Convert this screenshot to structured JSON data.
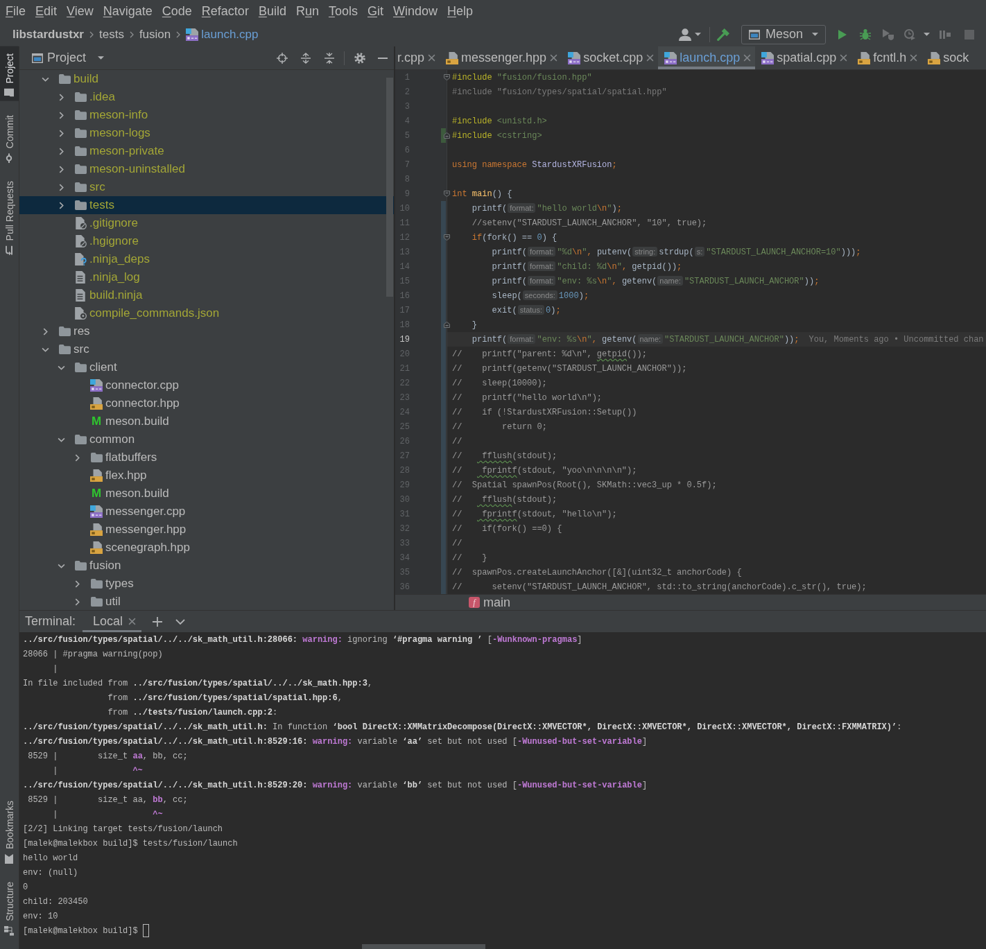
{
  "menu_bar": [
    {
      "label": "File",
      "kind": "first"
    },
    {
      "label": "Edit",
      "kind": "first"
    },
    {
      "label": "View",
      "kind": "first"
    },
    {
      "label": "Navigate",
      "kind": "first"
    },
    {
      "label": "Code",
      "kind": "first"
    },
    {
      "label": "Refactor",
      "kind": "first"
    },
    {
      "label": "Build",
      "kind": "first"
    },
    {
      "label": "Run",
      "kind": "second"
    },
    {
      "label": "Tools",
      "kind": "first"
    },
    {
      "label": "Git",
      "kind": "first"
    },
    {
      "label": "Window",
      "kind": "first"
    },
    {
      "label": "Help",
      "kind": "first"
    }
  ],
  "breadcrumbs": [
    {
      "label": "libstardustxr",
      "kind": "project",
      "modified": false
    },
    {
      "label": "tests",
      "kind": "folder",
      "modified": false
    },
    {
      "label": "fusion",
      "kind": "folder",
      "modified": false
    },
    {
      "label": "launch.cpp",
      "kind": "cpp",
      "modified": true
    }
  ],
  "run_configuration": {
    "label": "Meson"
  },
  "tool_windows": {
    "top": [
      {
        "label": "Project",
        "kind": "project",
        "selected": true
      },
      {
        "label": "Commit",
        "kind": "commit",
        "selected": false
      },
      {
        "label": "Pull Requests",
        "kind": "pull_requests",
        "selected": false
      }
    ],
    "bottom": [
      {
        "label": "Bookmarks",
        "kind": "bookmarks",
        "selected": false
      },
      {
        "label": "Structure",
        "kind": "structure",
        "selected": false
      }
    ]
  },
  "project_panel": {
    "title": "Project",
    "tree": [
      {
        "name": "build",
        "kind": "folder",
        "expanded": true,
        "excluded": true,
        "selected": false,
        "children": [
          {
            "name": ".idea",
            "kind": "folder",
            "expanded": false,
            "excluded": true,
            "selected": false
          },
          {
            "name": "meson-info",
            "kind": "folder",
            "expanded": false,
            "excluded": true,
            "selected": false
          },
          {
            "name": "meson-logs",
            "kind": "folder",
            "expanded": false,
            "excluded": true,
            "selected": false
          },
          {
            "name": "meson-private",
            "kind": "folder",
            "expanded": false,
            "excluded": true,
            "selected": false
          },
          {
            "name": "meson-uninstalled",
            "kind": "folder",
            "expanded": false,
            "excluded": true,
            "selected": false
          },
          {
            "name": "src",
            "kind": "folder",
            "expanded": false,
            "excluded": true,
            "selected": false
          },
          {
            "name": "tests",
            "kind": "folder",
            "expanded": false,
            "excluded": true,
            "selected": true
          },
          {
            "name": ".gitignore",
            "kind": "ignore",
            "excluded": true,
            "selected": false
          },
          {
            "name": ".hgignore",
            "kind": "ignore",
            "excluded": true,
            "selected": false
          },
          {
            "name": ".ninja_deps",
            "kind": "unknown",
            "excluded": true,
            "selected": false
          },
          {
            "name": ".ninja_log",
            "kind": "text",
            "excluded": true,
            "selected": false
          },
          {
            "name": "build.ninja",
            "kind": "text",
            "excluded": true,
            "selected": false
          },
          {
            "name": "compile_commands.json",
            "kind": "json",
            "excluded": true,
            "selected": false
          }
        ]
      },
      {
        "name": "res",
        "kind": "folder",
        "expanded": false,
        "excluded": false,
        "selected": false
      },
      {
        "name": "src",
        "kind": "folder",
        "expanded": true,
        "excluded": false,
        "selected": false,
        "children": [
          {
            "name": "client",
            "kind": "folder",
            "expanded": true,
            "excluded": false,
            "selected": false,
            "children": [
              {
                "name": "connector.cpp",
                "kind": "cpp",
                "excluded": false,
                "selected": false
              },
              {
                "name": "connector.hpp",
                "kind": "header",
                "excluded": false,
                "selected": false
              },
              {
                "name": "meson.build",
                "kind": "meson",
                "glyph": "M",
                "excluded": false,
                "selected": false
              }
            ]
          },
          {
            "name": "common",
            "kind": "folder",
            "expanded": true,
            "excluded": false,
            "selected": false,
            "children": [
              {
                "name": "flatbuffers",
                "kind": "folder",
                "expanded": false,
                "excluded": false,
                "selected": false
              },
              {
                "name": "flex.hpp",
                "kind": "header",
                "excluded": false,
                "selected": false
              },
              {
                "name": "meson.build",
                "kind": "meson",
                "glyph": "M",
                "excluded": false,
                "selected": false
              },
              {
                "name": "messenger.cpp",
                "kind": "cpp",
                "excluded": false,
                "selected": false
              },
              {
                "name": "messenger.hpp",
                "kind": "header",
                "excluded": false,
                "selected": false
              },
              {
                "name": "scenegraph.hpp",
                "kind": "header",
                "excluded": false,
                "selected": false
              }
            ]
          },
          {
            "name": "fusion",
            "kind": "folder",
            "expanded": true,
            "excluded": false,
            "selected": false,
            "children": [
              {
                "name": "types",
                "kind": "folder",
                "expanded": false,
                "excluded": false,
                "selected": false
              },
              {
                "name": "util",
                "kind": "folder",
                "expanded": false,
                "excluded": false,
                "selected": false
              }
            ]
          }
        ]
      }
    ]
  },
  "editor": {
    "tabs": [
      {
        "label": "r.cpp",
        "kind": "plain",
        "selected": false,
        "modified": false,
        "closable": true
      },
      {
        "label": "messenger.hpp",
        "kind": "header",
        "selected": false,
        "modified": false,
        "closable": true
      },
      {
        "label": "socket.cpp",
        "kind": "cpp",
        "selected": false,
        "modified": false,
        "closable": true
      },
      {
        "label": "launch.cpp",
        "kind": "cpp",
        "selected": true,
        "modified": true,
        "closable": true
      },
      {
        "label": "spatial.cpp",
        "kind": "cpp",
        "selected": false,
        "modified": false,
        "closable": true
      },
      {
        "label": "fcntl.h",
        "kind": "header",
        "selected": false,
        "modified": false,
        "closable": true
      },
      {
        "label": "sock",
        "kind": "header",
        "selected": false,
        "modified": false,
        "closable": false
      }
    ],
    "lines": [
      {
        "number": "1",
        "kind": "plain",
        "current": false,
        "fold_start": true,
        "tokens": [
          {
            "kind": "directive",
            "text": "#include"
          },
          {
            "kind": "string",
            "text": " \"fusion/fusion.hpp\""
          }
        ]
      },
      {
        "number": "2",
        "kind": "plain",
        "current": false,
        "tokens": [
          {
            "kind": "unused",
            "text": "#include \"fusion/types/spatial/spatial.hpp\""
          }
        ]
      },
      {
        "number": "3",
        "kind": "plain",
        "current": false
      },
      {
        "number": "4",
        "kind": "plain",
        "current": false,
        "tokens": [
          {
            "kind": "directive",
            "text": "#include"
          },
          {
            "kind": "string",
            "text": " <unistd.h>"
          }
        ]
      },
      {
        "number": "5",
        "kind": "added",
        "current": false,
        "fold_end": true,
        "tokens": [
          {
            "kind": "directive",
            "text": "#include"
          },
          {
            "kind": "string",
            "text": " <cstring>"
          }
        ]
      },
      {
        "number": "6",
        "kind": "plain",
        "current": false
      },
      {
        "number": "7",
        "kind": "plain",
        "current": false,
        "tokens": [
          {
            "kind": "keyword",
            "text": "using namespace "
          },
          {
            "kind": "namespace",
            "text": "StardustXRFusion"
          },
          {
            "kind": "keyword",
            "text": ";"
          }
        ]
      },
      {
        "number": "8",
        "kind": "plain",
        "current": false
      },
      {
        "number": "9",
        "kind": "plain",
        "current": false,
        "fold_start": true,
        "tokens": [
          {
            "kind": "keyword",
            "text": "int "
          },
          {
            "kind": "function",
            "text": "main"
          },
          {
            "kind": "plain",
            "text": "() {"
          }
        ],
        "children": [
          {
            "number": "10",
            "kind": "modified",
            "current": false,
            "tokens": [
              {
                "kind": "plain",
                "text": "printf("
              },
              {
                "kind": "hint",
                "text": "format:"
              },
              {
                "kind": "string",
                "text": "\"hello world"
              },
              {
                "kind": "escape",
                "text": "\\n"
              },
              {
                "kind": "string",
                "text": "\""
              },
              {
                "kind": "plain",
                "text": ")"
              },
              {
                "kind": "keyword",
                "text": ";"
              }
            ]
          },
          {
            "number": "11",
            "kind": "modified",
            "current": false,
            "tokens": [
              {
                "kind": "comment",
                "text": "//setenv(\"STARDUST_LAUNCH_ANCHOR\", \"10\", true);"
              }
            ]
          },
          {
            "number": "12",
            "kind": "modified",
            "current": false,
            "fold_start": true,
            "tokens": [
              {
                "kind": "keyword",
                "text": "if"
              },
              {
                "kind": "plain",
                "text": "(fork() == "
              },
              {
                "kind": "number",
                "text": "0"
              },
              {
                "kind": "plain",
                "text": ") {"
              }
            ],
            "children": [
              {
                "number": "13",
                "kind": "modified",
                "current": false,
                "tokens": [
                  {
                    "kind": "plain",
                    "text": "printf("
                  },
                  {
                    "kind": "hint",
                    "text": "format:"
                  },
                  {
                    "kind": "string",
                    "text": "\"%d"
                  },
                  {
                    "kind": "escape",
                    "text": "\\n"
                  },
                  {
                    "kind": "string",
                    "text": "\""
                  },
                  {
                    "kind": "keyword",
                    "text": ", "
                  },
                  {
                    "kind": "plain",
                    "text": "putenv("
                  },
                  {
                    "kind": "hint",
                    "text": "string:"
                  },
                  {
                    "kind": "plain",
                    "text": "strdup("
                  },
                  {
                    "kind": "hint",
                    "text": "s:"
                  },
                  {
                    "kind": "string",
                    "text": "\"STARDUST_LAUNCH_ANCHOR=10\""
                  },
                  {
                    "kind": "plain",
                    "text": ")))"
                  },
                  {
                    "kind": "keyword",
                    "text": ";"
                  }
                ]
              },
              {
                "number": "14",
                "kind": "modified",
                "current": false,
                "tokens": [
                  {
                    "kind": "plain",
                    "text": "printf("
                  },
                  {
                    "kind": "hint",
                    "text": "format:"
                  },
                  {
                    "kind": "string",
                    "text": "\"child: %d"
                  },
                  {
                    "kind": "escape",
                    "text": "\\n"
                  },
                  {
                    "kind": "string",
                    "text": "\""
                  },
                  {
                    "kind": "keyword",
                    "text": ", "
                  },
                  {
                    "kind": "plain",
                    "text": "getpid())"
                  },
                  {
                    "kind": "keyword",
                    "text": ";"
                  }
                ]
              },
              {
                "number": "15",
                "kind": "modified",
                "current": false,
                "tokens": [
                  {
                    "kind": "plain",
                    "text": "printf("
                  },
                  {
                    "kind": "hint",
                    "text": "format:"
                  },
                  {
                    "kind": "string",
                    "text": "\"env: %s"
                  },
                  {
                    "kind": "escape",
                    "text": "\\n"
                  },
                  {
                    "kind": "string",
                    "text": "\""
                  },
                  {
                    "kind": "keyword",
                    "text": ", "
                  },
                  {
                    "kind": "plain",
                    "text": "getenv("
                  },
                  {
                    "kind": "hint",
                    "text": "name:"
                  },
                  {
                    "kind": "string",
                    "text": "\"STARDUST_LAUNCH_ANCHOR\""
                  },
                  {
                    "kind": "plain",
                    "text": "))"
                  },
                  {
                    "kind": "keyword",
                    "text": ";"
                  }
                ]
              },
              {
                "number": "16",
                "kind": "modified",
                "current": false,
                "tokens": [
                  {
                    "kind": "plain",
                    "text": "sleep("
                  },
                  {
                    "kind": "hint",
                    "text": "seconds:"
                  },
                  {
                    "kind": "number",
                    "text": "1000"
                  },
                  {
                    "kind": "plain",
                    "text": ")"
                  },
                  {
                    "kind": "keyword",
                    "text": ";"
                  }
                ]
              },
              {
                "number": "17",
                "kind": "modified",
                "current": false,
                "tokens": [
                  {
                    "kind": "plain",
                    "text": "exit("
                  },
                  {
                    "kind": "hint",
                    "text": "status:"
                  },
                  {
                    "kind": "number",
                    "text": "0"
                  },
                  {
                    "kind": "plain",
                    "text": ")"
                  },
                  {
                    "kind": "keyword",
                    "text": ";"
                  }
                ]
              }
            ]
          },
          {
            "number": "18",
            "kind": "modified",
            "current": false,
            "fold_end": true,
            "tokens": [
              {
                "kind": "plain",
                "text": "}"
              }
            ]
          },
          {
            "number": "19",
            "kind": "modified",
            "current": true,
            "tokens": [
              {
                "kind": "plain",
                "text": "printf("
              },
              {
                "kind": "hint",
                "text": "format:"
              },
              {
                "kind": "string",
                "text": "\"env: %s"
              },
              {
                "kind": "escape",
                "text": "\\n"
              },
              {
                "kind": "string",
                "text": "\""
              },
              {
                "kind": "keyword",
                "text": ", "
              },
              {
                "kind": "plain",
                "text": "getenv("
              },
              {
                "kind": "hint",
                "text": "name:"
              },
              {
                "kind": "string",
                "text": "\"STARDUST_LAUNCH_ANCHOR\""
              },
              {
                "kind": "plain",
                "text": "))"
              },
              {
                "kind": "keyword",
                "text": ";"
              }
            ],
            "annotation": "You, Moments ago • Uncommitted chan"
          }
        ]
      },
      {
        "number": "20",
        "kind": "modified",
        "current": false,
        "tokens": [
          {
            "kind": "comment",
            "text": "//"
          },
          {
            "kind": "space4"
          },
          {
            "kind": "comment",
            "text": "printf(\"parent: %d\\n\", "
          },
          {
            "kind": "squiggle",
            "text": "getpid"
          },
          {
            "kind": "comment",
            "text": "());"
          }
        ]
      },
      {
        "number": "21",
        "kind": "modified",
        "current": false,
        "tokens": [
          {
            "kind": "comment",
            "text": "//"
          },
          {
            "kind": "space4"
          },
          {
            "kind": "comment",
            "text": "printf(getenv(\"STARDUST_LAUNCH_ANCHOR\"));"
          }
        ]
      },
      {
        "number": "22",
        "kind": "modified",
        "current": false,
        "tokens": [
          {
            "kind": "comment",
            "text": "//"
          },
          {
            "kind": "space4"
          },
          {
            "kind": "comment",
            "text": "sleep(10000);"
          }
        ]
      },
      {
        "number": "23",
        "kind": "modified",
        "current": false,
        "tokens": [
          {
            "kind": "comment",
            "text": "//"
          },
          {
            "kind": "space4"
          },
          {
            "kind": "comment",
            "text": "printf(\"hello world\\n\");"
          }
        ]
      },
      {
        "number": "24",
        "kind": "modified",
        "current": false,
        "tokens": [
          {
            "kind": "comment",
            "text": "//"
          },
          {
            "kind": "space4"
          },
          {
            "kind": "comment",
            "text": "if (!StardustXRFusion::Setup())"
          }
        ]
      },
      {
        "number": "25",
        "kind": "modified",
        "current": false,
        "tokens": [
          {
            "kind": "comment",
            "text": "//"
          },
          {
            "kind": "space8"
          },
          {
            "kind": "comment",
            "text": "return 0;"
          }
        ]
      },
      {
        "number": "26",
        "kind": "modified",
        "current": false,
        "tokens": [
          {
            "kind": "comment",
            "text": "//"
          }
        ]
      },
      {
        "number": "27",
        "kind": "modified",
        "current": false,
        "tokens": [
          {
            "kind": "comment",
            "text": "//"
          },
          {
            "kind": "space4"
          },
          {
            "kind": "squiggle",
            "text": "fflush"
          },
          {
            "kind": "comment",
            "text": "(stdout);"
          }
        ]
      },
      {
        "number": "28",
        "kind": "modified",
        "current": false,
        "tokens": [
          {
            "kind": "comment",
            "text": "//"
          },
          {
            "kind": "space4"
          },
          {
            "kind": "squiggle",
            "text": "fprintf"
          },
          {
            "kind": "comment",
            "text": "(stdout, \"yoo\\n\\n\\n\\n\");"
          }
        ]
      },
      {
        "number": "29",
        "kind": "modified",
        "current": false,
        "tokens": [
          {
            "kind": "comment",
            "text": "//"
          },
          {
            "kind": "space2"
          },
          {
            "kind": "comment",
            "text": "Spatial spawnPos(Root(), SKMath::vec3_up * 0.5f);"
          }
        ]
      },
      {
        "number": "30",
        "kind": "modified",
        "current": false,
        "tokens": [
          {
            "kind": "comment",
            "text": "//"
          },
          {
            "kind": "space4"
          },
          {
            "kind": "squiggle",
            "text": "fflush"
          },
          {
            "kind": "comment",
            "text": "(stdout);"
          }
        ]
      },
      {
        "number": "31",
        "kind": "modified",
        "current": false,
        "tokens": [
          {
            "kind": "comment",
            "text": "//"
          },
          {
            "kind": "space4"
          },
          {
            "kind": "squiggle",
            "text": "fprintf"
          },
          {
            "kind": "comment",
            "text": "(stdout, \"hello\\n\");"
          }
        ]
      },
      {
        "number": "32",
        "kind": "modified",
        "current": false,
        "tokens": [
          {
            "kind": "comment",
            "text": "//"
          },
          {
            "kind": "space4"
          },
          {
            "kind": "comment",
            "text": "if(fork() ==0) {"
          }
        ]
      },
      {
        "number": "33",
        "kind": "modified",
        "current": false,
        "tokens": [
          {
            "kind": "comment",
            "text": "//"
          }
        ]
      },
      {
        "number": "34",
        "kind": "modified",
        "current": false,
        "tokens": [
          {
            "kind": "comment",
            "text": "//"
          },
          {
            "kind": "space4"
          },
          {
            "kind": "comment",
            "text": "}"
          }
        ]
      },
      {
        "number": "35",
        "kind": "modified",
        "current": false,
        "tokens": [
          {
            "kind": "comment",
            "text": "//"
          },
          {
            "kind": "space2"
          },
          {
            "kind": "comment",
            "text": "spawnPos.createLaunchAnchor([&](uint32_t anchorCode) {"
          }
        ]
      },
      {
        "number": "36",
        "kind": "modified",
        "current": false,
        "tokens": [
          {
            "kind": "comment",
            "text": "//"
          },
          {
            "kind": "space6"
          },
          {
            "kind": "comment",
            "text": "setenv(\"STARDUST_LAUNCH_ANCHOR\", std::to_string(anchorCode).c_str(), true);"
          }
        ]
      }
    ],
    "breadcrumb": {
      "glyph": "f",
      "label": "main"
    }
  },
  "terminal": {
    "title": "Terminal:",
    "tabs": [
      {
        "label": "Local",
        "selected": true,
        "closable": true
      }
    ],
    "cursor": true,
    "lines": [
      {
        "tokens": [
          {
            "kind": "bold",
            "text": "../src/fusion/types/spatial/../../sk_math_util.h:28066:"
          },
          {
            "kind": "space1"
          },
          {
            "kind": "warning",
            "text": "warning:"
          },
          {
            "kind": "plain",
            "text": " ignoring "
          },
          {
            "kind": "bold",
            "text": "‘#pragma warning ’"
          },
          {
            "kind": "plain",
            "text": " ["
          },
          {
            "kind": "warning",
            "text": "-Wunknown-pragmas"
          },
          {
            "kind": "plain",
            "text": "]"
          }
        ]
      },
      {
        "tokens": [
          {
            "kind": "plain",
            "text": "28066 | #pragma warning(pop)"
          }
        ]
      },
      {
        "tokens": [
          {
            "kind": "space6"
          },
          {
            "kind": "plain",
            "text": "|"
          }
        ]
      },
      {
        "tokens": [
          {
            "kind": "plain",
            "text": "In file included from "
          },
          {
            "kind": "bold",
            "text": "../src/fusion/types/spatial/../../sk_math.hpp:3"
          },
          {
            "kind": "plain",
            "text": ","
          }
        ]
      },
      {
        "tokens": [
          {
            "kind": "space17"
          },
          {
            "kind": "plain",
            "text": "from "
          },
          {
            "kind": "bold",
            "text": "../src/fusion/types/spatial/spatial.hpp:6"
          },
          {
            "kind": "plain",
            "text": ","
          }
        ]
      },
      {
        "tokens": [
          {
            "kind": "space17"
          },
          {
            "kind": "plain",
            "text": "from "
          },
          {
            "kind": "bold",
            "text": "../tests/fusion/launch.cpp:2"
          },
          {
            "kind": "plain",
            "text": ":"
          }
        ]
      },
      {
        "tokens": [
          {
            "kind": "bold",
            "text": "../src/fusion/types/spatial/../../sk_math_util.h:"
          },
          {
            "kind": "plain",
            "text": " In function "
          },
          {
            "kind": "bold",
            "text": "‘bool DirectX::XMMatrixDecompose(DirectX::XMVECTOR*, DirectX::XMVECTOR*, DirectX::XMVECTOR*, DirectX::FXMMATRIX)’"
          },
          {
            "kind": "plain",
            "text": ":"
          }
        ]
      },
      {
        "tokens": [
          {
            "kind": "bold",
            "text": "../src/fusion/types/spatial/../../sk_math_util.h:8529:16:"
          },
          {
            "kind": "space1"
          },
          {
            "kind": "warning",
            "text": "warning:"
          },
          {
            "kind": "plain",
            "text": " variable "
          },
          {
            "kind": "bold",
            "text": "‘aa’"
          },
          {
            "kind": "plain",
            "text": " set but not used ["
          },
          {
            "kind": "warning",
            "text": "-Wunused-but-set-variable"
          },
          {
            "kind": "plain",
            "text": "]"
          }
        ]
      },
      {
        "tokens": [
          {
            "kind": "space1"
          },
          {
            "kind": "plain",
            "text": "8529 |"
          },
          {
            "kind": "space8"
          },
          {
            "kind": "plain",
            "text": "size_t "
          },
          {
            "kind": "warning",
            "text": "aa"
          },
          {
            "kind": "plain",
            "text": ", bb, cc;"
          }
        ]
      },
      {
        "tokens": [
          {
            "kind": "space6"
          },
          {
            "kind": "plain",
            "text": "|"
          },
          {
            "kind": "space15"
          },
          {
            "kind": "warning",
            "text": "^~"
          }
        ]
      },
      {
        "tokens": [
          {
            "kind": "bold",
            "text": "../src/fusion/types/spatial/../../sk_math_util.h:8529:20:"
          },
          {
            "kind": "space1"
          },
          {
            "kind": "warning",
            "text": "warning:"
          },
          {
            "kind": "plain",
            "text": " variable "
          },
          {
            "kind": "bold",
            "text": "‘bb’"
          },
          {
            "kind": "plain",
            "text": " set but not used ["
          },
          {
            "kind": "warning",
            "text": "-Wunused-but-set-variable"
          },
          {
            "kind": "plain",
            "text": "]"
          }
        ]
      },
      {
        "tokens": [
          {
            "kind": "space1"
          },
          {
            "kind": "plain",
            "text": "8529 |"
          },
          {
            "kind": "space8"
          },
          {
            "kind": "plain",
            "text": "size_t aa, "
          },
          {
            "kind": "warning",
            "text": "bb"
          },
          {
            "kind": "plain",
            "text": ", cc;"
          }
        ]
      },
      {
        "tokens": [
          {
            "kind": "space6"
          },
          {
            "kind": "plain",
            "text": "|"
          },
          {
            "kind": "space19"
          },
          {
            "kind": "warning",
            "text": "^~"
          }
        ]
      },
      {
        "tokens": [
          {
            "kind": "plain",
            "text": "[2/2] Linking target tests/fusion/launch"
          }
        ]
      },
      {
        "tokens": [
          {
            "kind": "plain",
            "text": "[malek@malekbox build]$ tests/fusion/launch"
          }
        ]
      },
      {
        "tokens": [
          {
            "kind": "plain",
            "text": "hello world"
          }
        ]
      },
      {
        "tokens": [
          {
            "kind": "plain",
            "text": "env: (null)"
          }
        ]
      },
      {
        "tokens": [
          {
            "kind": "plain",
            "text": "0"
          }
        ]
      },
      {
        "tokens": [
          {
            "kind": "plain",
            "text": "child: 203450"
          }
        ]
      },
      {
        "tokens": [
          {
            "kind": "plain",
            "text": "env: 10"
          }
        ]
      },
      {
        "tokens": [
          {
            "kind": "plain",
            "text": "[malek@malekbox build]$"
          }
        ]
      }
    ]
  }
}
